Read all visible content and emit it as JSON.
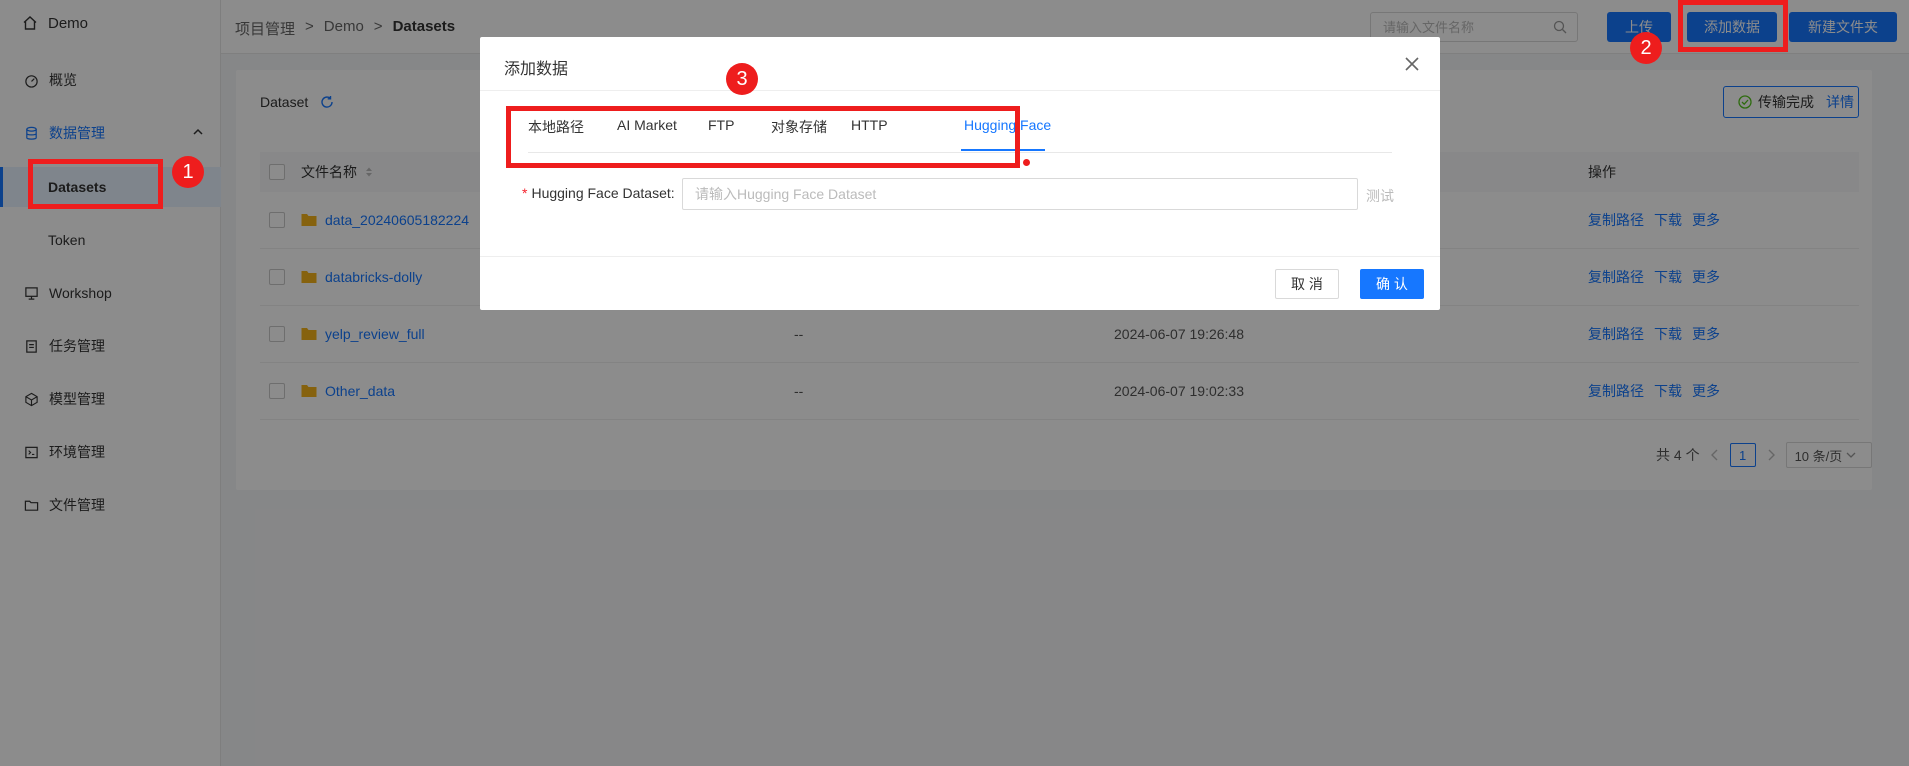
{
  "app": {
    "name": "Demo"
  },
  "sidebar": {
    "items": [
      {
        "label": "概览",
        "icon": "dashboard-icon"
      },
      {
        "label": "数据管理",
        "icon": "database-icon"
      },
      {
        "label": "Datasets"
      },
      {
        "label": "Token"
      },
      {
        "label": "Workshop",
        "icon": "workshop-icon"
      },
      {
        "label": "任务管理",
        "icon": "task-icon"
      },
      {
        "label": "模型管理",
        "icon": "model-icon"
      },
      {
        "label": "环境管理",
        "icon": "environment-icon"
      },
      {
        "label": "文件管理",
        "icon": "folder-manage-icon"
      }
    ]
  },
  "header": {
    "breadcrumb": [
      "项目管理",
      "Demo",
      "Datasets"
    ],
    "breadcrumb_separator": ">",
    "search_placeholder": "请输入文件名称",
    "upload_label": "上传",
    "add_data_label": "添加数据",
    "new_folder_label": "新建文件夹"
  },
  "main": {
    "title": "Dataset",
    "status_text": "传输完成",
    "status_link": "详情",
    "columns": {
      "name": "文件名称",
      "actions": "操作"
    },
    "rows": [
      {
        "name": "data_20240605182224",
        "size": "",
        "time": ""
      },
      {
        "name": "databricks-dolly",
        "size": "",
        "time": ""
      },
      {
        "name": "yelp_review_full",
        "size": "--",
        "time": "2024-06-07 19:26:48"
      },
      {
        "name": "Other_data",
        "size": "--",
        "time": "2024-06-07 19:02:33"
      }
    ],
    "row_actions": [
      "复制路径",
      "下载",
      "更多"
    ],
    "pagination": {
      "total": "共 4 个",
      "current": "1",
      "page_size": "10 条/页"
    }
  },
  "modal": {
    "title": "添加数据",
    "tabs": [
      "本地路径",
      "AI Market",
      "FTP",
      "对象存储",
      "HTTP",
      "Hugging Face"
    ],
    "active_tab": "Hugging Face",
    "field_label": "Hugging Face Dataset:",
    "field_placeholder": "请输入Hugging Face Dataset",
    "test_label": "测试",
    "cancel_label": "取 消",
    "confirm_label": "确 认"
  },
  "annotations": [
    "1",
    "2",
    "3"
  ],
  "colors": {
    "primary": "#1677ff",
    "highlight": "#ee1d1d",
    "folder": "#f5b31b"
  }
}
